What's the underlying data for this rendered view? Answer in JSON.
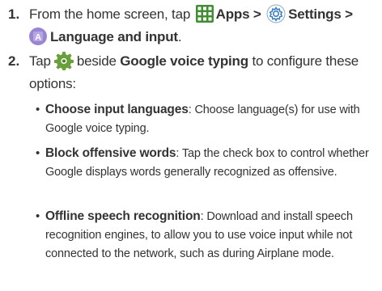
{
  "step1": {
    "number": "1.",
    "prefix": "From the home screen, tap",
    "apps_label": "Apps >",
    "settings_label": "Settings >",
    "language_label": "Language and input",
    "end": "."
  },
  "step2": {
    "number": "2.",
    "prefix": "Tap",
    "middle": "beside",
    "google_voice_label": "Google voice typing",
    "suffix": "to configure these options:"
  },
  "options": [
    {
      "label": "Choose input languages",
      "desc": ": Choose language(s) for use with Google voice typing."
    },
    {
      "label": "Block offensive words",
      "desc": ": Tap the check box to control whether Google displays words generally recognized as offensive."
    },
    {
      "label": "Offline speech recognition",
      "desc": ": Download and install speech recognition engines, to allow you to use voice input while not connected to the network, such as during Airplane mode."
    }
  ],
  "colors": {
    "text": "#333333",
    "apps_icon": "#4a9a3c",
    "settings_icon": "#3a7fc1",
    "language_icon": "#8a6fc6",
    "gear_icon": "#6aa03a"
  },
  "icons": [
    "apps-grid-icon",
    "settings-gear-icon",
    "language-input-icon",
    "gear-icon"
  ]
}
